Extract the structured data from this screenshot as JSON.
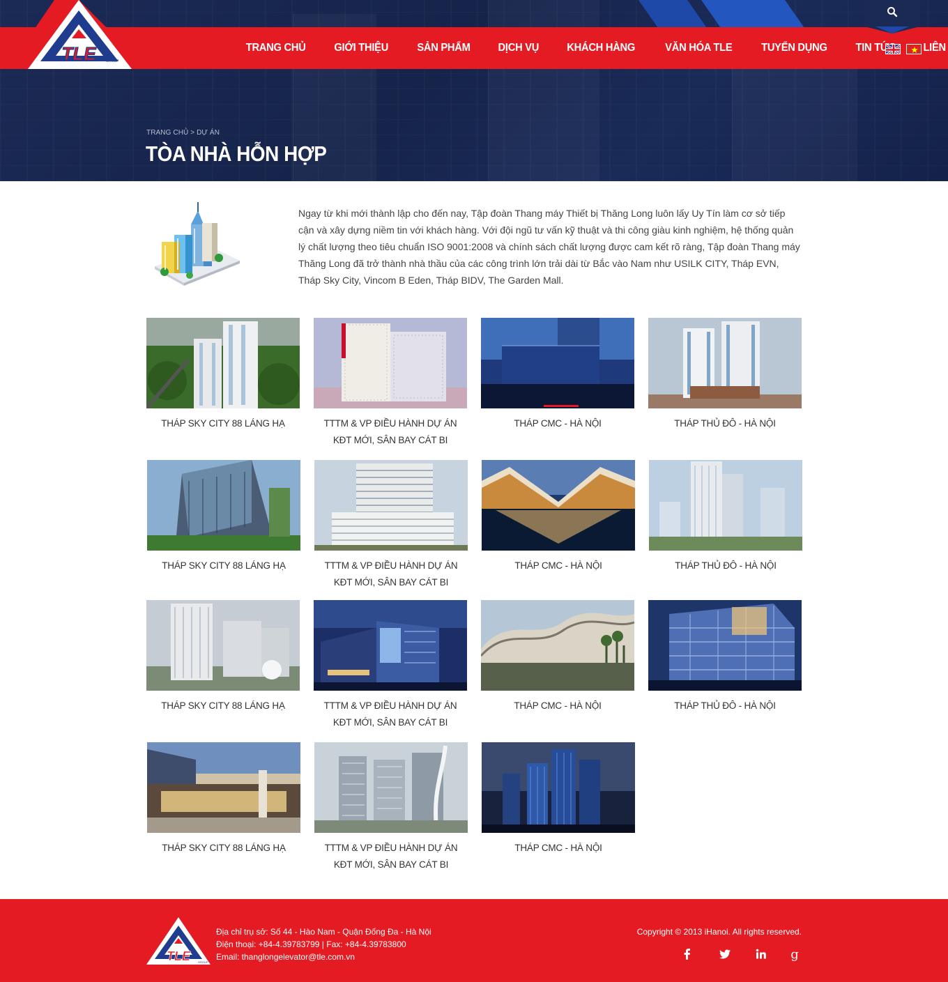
{
  "header": {
    "logo_text": "TLE",
    "logo_subtext": "GROUP",
    "nav": [
      {
        "label": "TRANG CHỦ"
      },
      {
        "label": "GIỚI THIỆU"
      },
      {
        "label": "SẢN PHẨM"
      },
      {
        "label": "DỊCH VỤ"
      },
      {
        "label": "KHÁCH HÀNG"
      },
      {
        "label": "VĂN HÓA TLE"
      },
      {
        "label": "TUYỂN DỤNG"
      },
      {
        "label": "TIN TỨC"
      },
      {
        "label": "LIÊN HỆ"
      }
    ],
    "languages": [
      {
        "icon": "uk-flag-icon"
      },
      {
        "icon": "vietnam-flag-icon"
      }
    ],
    "search_icon": "search-icon"
  },
  "breadcrumb": {
    "home": "TRANG CHỦ",
    "separator": ">",
    "current": "DỰ ÁN"
  },
  "page": {
    "title": "TÒA NHÀ HỖN HỢP",
    "intro": "Ngay từ khi mới thành lập cho đến nay, Tập đoàn Thang máy Thiết bị Thăng Long luôn lấy Uy Tín làm cơ sở tiếp cận và xây dựng niềm tin với khách hàng. Với đội ngũ tư vấn kỹ thuật và thi công giàu kinh nghiệm, hệ thống quản lý chất lượng theo tiêu chuẩn ISO 9001:2008 và chính sách chất lượng được cam kết rõ ràng, Tập đoàn Thang máy Thăng Long đã trở thành nhà thầu của các công trình lớn trải dài từ Bắc vào Nam như USILK CITY, Tháp EVN, Tháp Sky City, Vincom B Eden, Tháp BIDV, The Garden Mall."
  },
  "projects": [
    {
      "title": "THÁP SKY CITY 88 LÁNG HẠ"
    },
    {
      "title": "TTTM & VP ĐIỀU HÀNH DỰ ÁN KĐT MỚI, SÂN BAY CÁT BI"
    },
    {
      "title": "THÁP CMC - HÀ NỘI"
    },
    {
      "title": "THÁP THỦ ĐÔ - HÀ NỘI"
    },
    {
      "title": "THÁP SKY CITY 88 LÁNG HẠ"
    },
    {
      "title": "TTTM & VP ĐIỀU HÀNH DỰ ÁN KĐT MỚI, SÂN BAY CÁT BI"
    },
    {
      "title": "THÁP CMC - HÀ NỘI"
    },
    {
      "title": "THÁP THỦ ĐÔ - HÀ NỘI"
    },
    {
      "title": "THÁP SKY CITY 88 LÁNG HẠ"
    },
    {
      "title": "TTTM & VP ĐIỀU HÀNH DỰ ÁN KĐT MỚI, SÂN BAY CÁT BI"
    },
    {
      "title": "THÁP CMC - HÀ NỘI"
    },
    {
      "title": "THÁP THỦ ĐÔ - HÀ NỘI"
    },
    {
      "title": "THÁP SKY CITY 88 LÁNG HẠ"
    },
    {
      "title": "TTTM & VP ĐIỀU HÀNH DỰ ÁN KĐT MỚI, SÂN BAY CÁT BI"
    },
    {
      "title": "THÁP CMC - HÀ NỘI"
    }
  ],
  "footer": {
    "address": "Địa chỉ trụ sở: Số 44 - Hào Nam - Quận Đống Đa - Hà Nội",
    "phone": "Điện thoại:  +84-4.39783799  |  Fax: +84-4.39783800",
    "email": "Email: thanglongelevator@tle.com.vn",
    "copyright": "Copyright © 2013 iHanoi. All rights reserved.",
    "social": [
      "facebook-icon",
      "twitter-icon",
      "linkedin-icon",
      "google-plus-icon"
    ]
  },
  "colors": {
    "brand_red": "#e51b23",
    "hero_navy": "#1b2a55",
    "accent_blue": "#1f49a8"
  }
}
